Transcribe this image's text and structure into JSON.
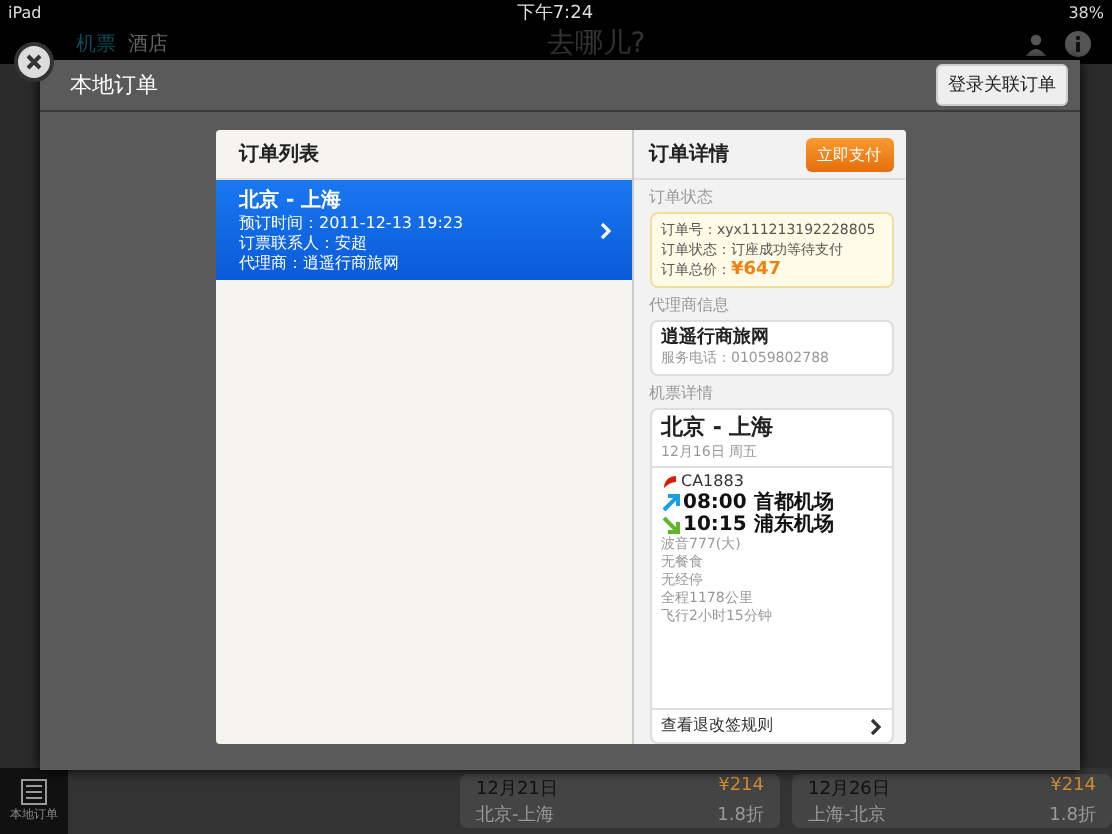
{
  "status_bar": {
    "device": "iPad",
    "time": "下午7:24",
    "battery": "38%"
  },
  "app_header": {
    "tabs": [
      {
        "label": "机票",
        "selected": true
      },
      {
        "label": "酒店",
        "selected": false
      }
    ],
    "logo": "去哪儿?"
  },
  "background_list": {
    "sidebar_label": "本地订单",
    "cards": [
      {
        "date": "12月21日",
        "route": "北京-上海",
        "price": "¥214",
        "discount": "1.8折"
      },
      {
        "date": "12月26日",
        "route": "上海-北京",
        "price": "¥214",
        "discount": "1.8折"
      }
    ]
  },
  "modal": {
    "title": "本地订单",
    "link_button": "登录关联订单",
    "order_list": {
      "title": "订单列表",
      "items": [
        {
          "route": "北京 - 上海",
          "lines": [
            "预订时间：2011-12-13 19:23",
            "订票联系人：安超",
            "代理商：逍遥行商旅网"
          ],
          "selected": true
        }
      ]
    },
    "details": {
      "title": "订单详情",
      "pay_button": "立即支付",
      "status_section": {
        "heading": "订单状态",
        "number": "订单号：xyx111213192228805",
        "state": "订单状态：订座成功等待支付",
        "total_label": "订单总价：",
        "total": "¥647"
      },
      "agent_section": {
        "heading": "代理商信息",
        "name": "逍遥行商旅网",
        "phone": "服务电话：01059802788"
      },
      "ticket_section": {
        "heading": "机票详情",
        "route": "北京 - 上海",
        "date": "12月16日  周五",
        "flight": "CA1883",
        "departure": {
          "time": "08:00",
          "airport": "首都机场"
        },
        "arrival": {
          "time": "10:15",
          "airport": "浦东机场"
        },
        "info": [
          "波音777(大)",
          "无餐食",
          "无经停",
          "全程1178公里",
          "飞行2小时15分钟"
        ],
        "rules_link": "查看退改签规则"
      }
    }
  }
}
